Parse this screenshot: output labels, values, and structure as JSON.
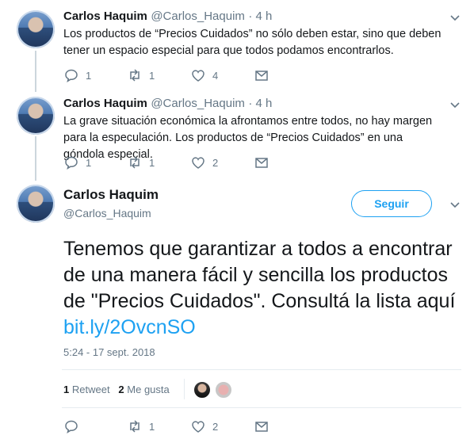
{
  "tweets": [
    {
      "name": "Carlos Haquim",
      "handle": "@Carlos_Haquim",
      "time": "· 4 h",
      "text": "Los productos de “Precios Cuidados” no sólo deben estar, sino que deben tener un espacio especial para que todos podamos encontrarlos.",
      "replies": "1",
      "retweets": "1",
      "likes": "4"
    },
    {
      "name": "Carlos Haquim",
      "handle": "@Carlos_Haquim",
      "time": "· 4 h",
      "text": "La grave situación económica la afrontamos entre todos, no hay margen para la especulación. Los productos de “Precios Cuidados” en una góndola especial.",
      "replies": "1",
      "retweets": "1",
      "likes": "2"
    }
  ],
  "main_tweet": {
    "name": "Carlos Haquim",
    "handle": "@Carlos_Haquim",
    "follow_label": "Seguir",
    "text": "Tenemos que garantizar a todos a encontrar de una manera fácil y sencilla los productos de \"Precios Cuidados\". Consultá la lista aquí ",
    "link": "bit.ly/2OvcnSO",
    "timestamp": "5:24 - 17 sept. 2018",
    "retweet_count": "1",
    "retweet_label": "Retweet",
    "like_count": "2",
    "like_label": "Me gusta",
    "replies": "",
    "retweets": "1",
    "likes": "2"
  },
  "colors": {
    "accent": "#1da1f2",
    "secondary_text": "#657786",
    "thread_line": "#ccd6dd"
  }
}
